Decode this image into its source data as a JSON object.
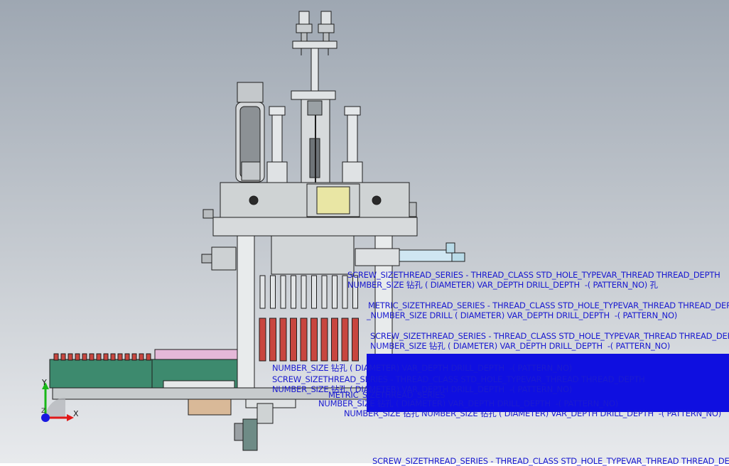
{
  "triad": {
    "x_label": "X",
    "y_label": "Y",
    "z_label": "Z"
  },
  "annotations": [
    "SCREW_SIZETHREAD_SERIES - THREAD_CLASS STD_HOLE_TYPEVAR_THREAD THREAD_DEPTH",
    "NUMBER_SIZE 钻孔 ( DIAMETER) VAR_DEPTH DRILL_DEPTH  -( PATTERN_NO) 孔",
    "METRIC_SIZETHREAD_SERIES - THREAD_CLASS STD_HOLE_TYPEVAR_THREAD THREAD_DEPTH",
    "_NUMBER_SIZE DRILL ( DIAMETER) VAR_DEPTH DRILL_DEPTH  -( PATTERN_NO)",
    "SCREW_SIZETHREAD_SERIES - THREAD_CLASS STD_HOLE_TYPEVAR_THREAD THREAD_DEPTH",
    "NUMBER_SIZE 钻孔 ( DIAMETER) VAR_DEPTH DRILL_DEPTH  -( PATTERN_NO)",
    "NUMBER_SIZE 钻孔 ( DIAMETER) VAR_DEPTH DRILL_DEPTH  -( PATTERN_NO)",
    "SCREW_SIZETHREAD_SERIES - THREAD_CLASS STD_HOLE_TYPEVAR_THREAD THREAD_DEPTH",
    "NUMBER_SIZE 钻孔 ( DIAMETER) VAR_DEPTH DRILL_DEPTH  -( PATTERN_NO)",
    "METRIC_SIZETHREAD_SERIES",
    "NUMBER_SIZE 钻孔 ( DIAMETER) VAR_DEPTH DRILL_DEPTH  -( PATTERN_NO)",
    "NUMBER_SIZE 钻孔 NUMBER_SIZE 钻孔 ( DIAMETER) VAR_DEPTH DRILL_DEPTH  -( PATTERN_NO)",
    "SCREW_SIZETHREAD_SERIES - THREAD_CLASS STD_HOLE_TYPEVAR_THREAD THREAD_DEPTH"
  ],
  "colors": {
    "annotation": "#1a1ad0",
    "frame": "#cfd3d4",
    "conveyor": "#3d8a6e",
    "cylinder_rod": "#c8463f",
    "valve_block": "#e9e6a4",
    "pink_rail": "#e4b8d8",
    "triad_x": "#e01818",
    "triad_y": "#18b818",
    "triad_z": "#1818e0"
  }
}
